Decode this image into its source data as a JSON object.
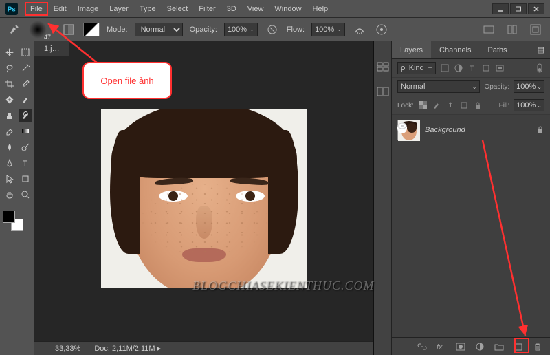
{
  "menubar": {
    "items": [
      "File",
      "Edit",
      "Image",
      "Layer",
      "Type",
      "Select",
      "Filter",
      "3D",
      "View",
      "Window",
      "Help"
    ],
    "highlighted_index": 0
  },
  "options": {
    "brush_size": "47",
    "mode_label": "Mode:",
    "mode_value": "Normal",
    "opacity_label": "Opacity:",
    "opacity_value": "100%",
    "flow_label": "Flow:",
    "flow_value": "100%"
  },
  "document": {
    "tab_label": "1.j…",
    "zoom": "33,33%",
    "doc_info_label": "Doc:",
    "doc_info_value": "2,11M/2,11M"
  },
  "panels": {
    "tabs": [
      "Layers",
      "Channels",
      "Paths"
    ],
    "active_tab": 0,
    "filter": {
      "kind_label": "Kind"
    },
    "blend": {
      "mode": "Normal",
      "opacity_label": "Opacity:",
      "opacity_value": "100%"
    },
    "lock": {
      "label": "Lock:",
      "fill_label": "Fill:",
      "fill_value": "100%"
    },
    "layers": [
      {
        "name": "Background",
        "locked": true,
        "visible": true
      }
    ]
  },
  "callout": {
    "text": "Open file ảnh"
  },
  "watermark": "BLOGCHIASEKIENTHUC.COM"
}
